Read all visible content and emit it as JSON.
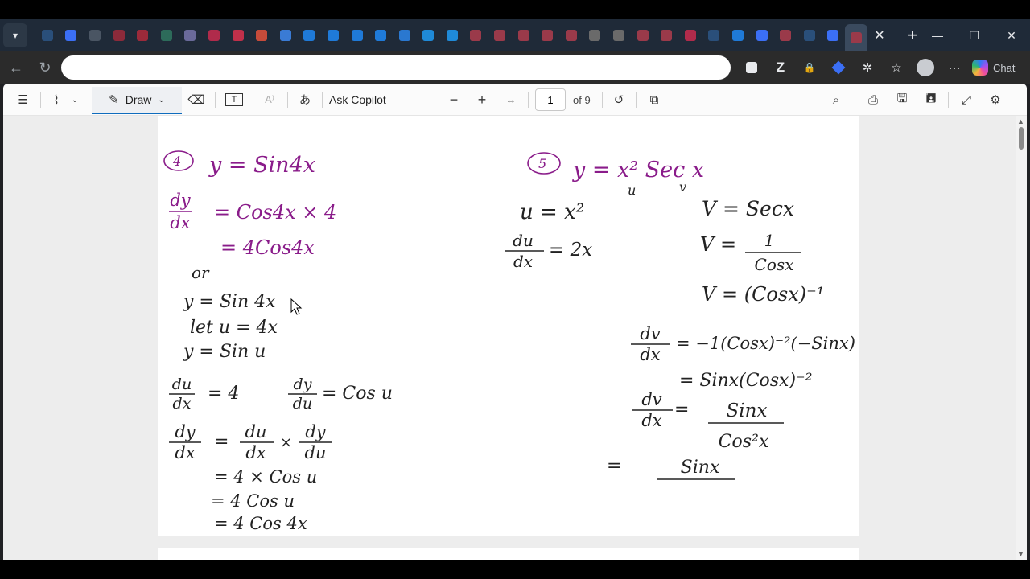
{
  "browser": {
    "tab_count": 34,
    "new_tab_symbol": "+",
    "close_tab_symbol": "✕",
    "address": {
      "value": "",
      "placeholder": ""
    },
    "chat_label": "Chat",
    "accent": "#0f6cbd"
  },
  "pdf_toolbar": {
    "draw_label": "Draw",
    "ask_copilot_label": "Ask Copilot",
    "page_current": "1",
    "page_total_label": "of 9"
  },
  "notes": {
    "q4": {
      "number": "4",
      "title": "y = Sin4x",
      "l1_num": "dy",
      "l1_den": "dx",
      "l1_rhs": "= Cos4x × 4",
      "l2": "= 4Cos4x",
      "or": "or",
      "l3": "y = Sin 4x",
      "l4": "let u = 4x",
      "l5": "y = Sin u",
      "du_num": "du",
      "du_den": "dx",
      "du_rhs": "= 4",
      "dyu_num": "dy",
      "dyu_den": "du",
      "dyu_rhs": "= Cos u",
      "cr_num": "dy",
      "cr_den": "dx",
      "cr_eq": "=",
      "cr_a_num": "du",
      "cr_a_den": "dx",
      "cr_times": "×",
      "cr_b_num": "dy",
      "cr_b_den": "du",
      "s1": "= 4 × Cos u",
      "s2": "= 4 Cos u",
      "s3": "= 4 Cos 4x"
    },
    "q5": {
      "number": "5",
      "title": "y = x² Sec x",
      "u_tag": "u",
      "v_tag": "v",
      "u_def": "u = x²",
      "du_num": "du",
      "du_den": "dx",
      "du_rhs": "= 2x",
      "v_def": "V = Secx",
      "v2_lhs": "V =",
      "v2_num": "1",
      "v2_den": "Cosx",
      "v3": "V = (Cosx)⁻¹",
      "dv_num": "dv",
      "dv_den": "dx",
      "dv_rhs": "= −1(Cosx)⁻²(−Sinx)",
      "dv2": "= Sinx(Cosx)⁻²",
      "dv3_num": "dv",
      "dv3_den": "dx",
      "dv3_eq": "=",
      "dv3_fnum": "Sinx",
      "dv3_fden": "Cos²x",
      "last_eq": "=",
      "last_num": "Sinx"
    }
  }
}
